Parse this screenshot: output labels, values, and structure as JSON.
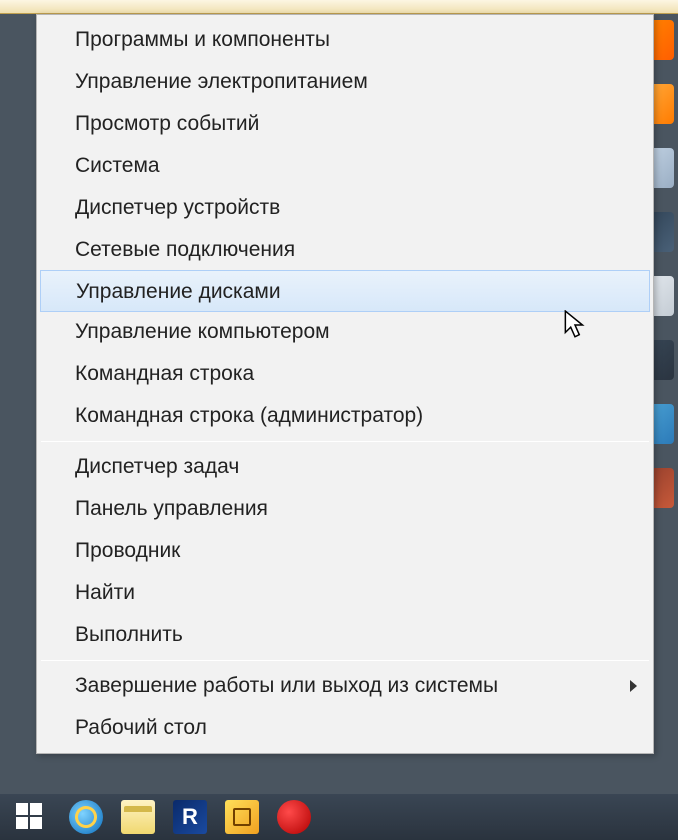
{
  "menu": {
    "groups": [
      {
        "items": [
          {
            "id": "programs-and-features",
            "label": "Программы и компоненты",
            "submenu": false
          },
          {
            "id": "power-options",
            "label": "Управление электропитанием",
            "submenu": false
          },
          {
            "id": "event-viewer",
            "label": "Просмотр событий",
            "submenu": false
          },
          {
            "id": "system",
            "label": "Система",
            "submenu": false
          },
          {
            "id": "device-manager",
            "label": "Диспетчер устройств",
            "submenu": false
          },
          {
            "id": "network-connections",
            "label": "Сетевые подключения",
            "submenu": false
          },
          {
            "id": "disk-management",
            "label": "Управление дисками",
            "submenu": false,
            "hover": true
          },
          {
            "id": "computer-management",
            "label": "Управление компьютером",
            "submenu": false
          },
          {
            "id": "command-prompt",
            "label": "Командная строка",
            "submenu": false
          },
          {
            "id": "command-prompt-admin",
            "label": "Командная строка (администратор)",
            "submenu": false
          }
        ]
      },
      {
        "items": [
          {
            "id": "task-manager",
            "label": "Диспетчер задач",
            "submenu": false
          },
          {
            "id": "control-panel",
            "label": "Панель управления",
            "submenu": false
          },
          {
            "id": "file-explorer",
            "label": "Проводник",
            "submenu": false
          },
          {
            "id": "search",
            "label": "Найти",
            "submenu": false
          },
          {
            "id": "run",
            "label": "Выполнить",
            "submenu": false
          }
        ]
      },
      {
        "items": [
          {
            "id": "shutdown-signout",
            "label": "Завершение работы или выход из системы",
            "submenu": true
          },
          {
            "id": "desktop",
            "label": "Рабочий стол",
            "submenu": false
          }
        ]
      }
    ]
  },
  "taskbar": {
    "start": "start",
    "r_label": "R"
  }
}
